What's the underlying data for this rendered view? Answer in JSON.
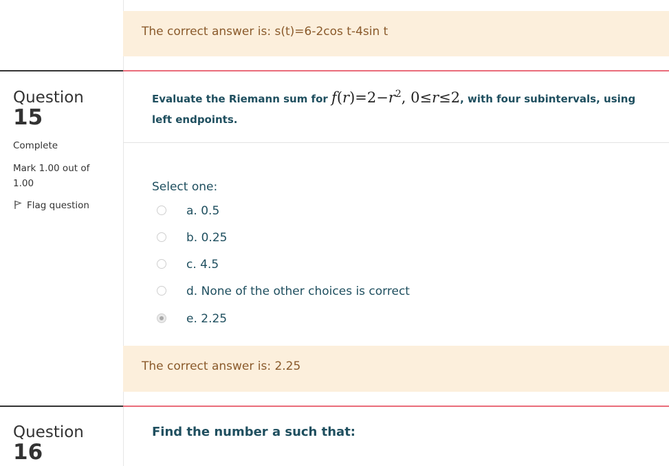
{
  "q14": {
    "feedback": "The correct answer is: s(t)=6-2cos t-4sin t"
  },
  "q15": {
    "question_word": "Question",
    "number": "15",
    "state": "Complete",
    "mark": "Mark 1.00 out of 1.00",
    "flag_label": "Flag question",
    "prompt_prefix": "Evaluate the Riemann sum for",
    "prompt_suffix": ", with four subintervals, using",
    "prompt_line2": "left endpoints.",
    "select_label": "Select one:",
    "options": [
      {
        "label": "a. 0.5",
        "checked": false
      },
      {
        "label": "b. 0.25",
        "checked": false
      },
      {
        "label": "c. 4.5",
        "checked": false
      },
      {
        "label": "d. None of the other choices is correct",
        "checked": false
      },
      {
        "label": "e. 2.25",
        "checked": true
      }
    ],
    "feedback": "The correct answer is: 2.25"
  },
  "q16": {
    "question_word": "Question",
    "number": "16",
    "prompt": "Find the number a such that:"
  },
  "colors": {
    "feedback_bg": "#fcefdc",
    "feedback_text": "#8a5a2b",
    "accent_rule": "#e96c7a",
    "prompt_text": "#1f4f5f"
  }
}
